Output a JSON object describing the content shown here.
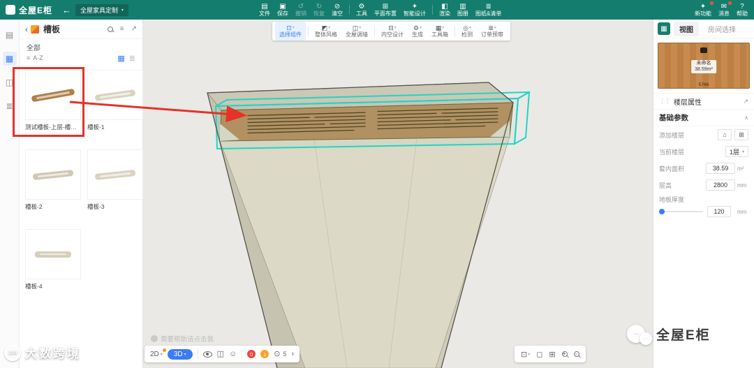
{
  "colors": {
    "topbar": "#157d6e",
    "accent": "#3b7bf6",
    "selection": "#2ed3c6",
    "annotation": "#e63228"
  },
  "app": {
    "logo_text": "全屋E柜",
    "workspace": "全屋家具定制"
  },
  "top_toolbar": {
    "items": [
      {
        "label": "文件",
        "icon": "file-icon"
      },
      {
        "label": "保存",
        "icon": "save-icon"
      },
      {
        "label": "撤销",
        "icon": "undo-icon",
        "disabled": true
      },
      {
        "label": "恢复",
        "icon": "redo-icon",
        "disabled": true
      },
      {
        "label": "清空",
        "icon": "clear-icon"
      },
      {
        "label": "工具",
        "icon": "tools-icon"
      },
      {
        "label": "平面布置",
        "icon": "floorplan-icon"
      },
      {
        "label": "智能设计",
        "icon": "smart-design-icon"
      },
      {
        "label": "渲染",
        "icon": "render-icon"
      },
      {
        "label": "图册",
        "icon": "album-icon"
      },
      {
        "label": "图纸&清单",
        "icon": "drawings-list-icon"
      }
    ],
    "right_items": [
      {
        "label": "新功能",
        "icon": "new-features-icon"
      },
      {
        "label": "消息",
        "icon": "messages-icon"
      },
      {
        "label": "帮助",
        "icon": "help-icon"
      }
    ]
  },
  "mode_toolbar": {
    "items": [
      {
        "label": "选择组件",
        "icon": "select-component-icon",
        "active": true
      },
      {
        "label": "整体风格",
        "icon": "overall-style-icon"
      },
      {
        "label": "全屋调墙",
        "icon": "wall-adjust-icon"
      },
      {
        "label": "内空设计",
        "icon": "interior-design-icon"
      },
      {
        "label": "生成",
        "icon": "generate-icon"
      },
      {
        "label": "工具箱",
        "icon": "toolbox-icon"
      },
      {
        "label": "检测",
        "icon": "detect-icon"
      },
      {
        "label": "订单预审",
        "icon": "order-review-icon"
      }
    ]
  },
  "left_panel": {
    "title": "槽板",
    "filter_all": "全部",
    "group_label": "A-Z",
    "items": [
      {
        "label": "测试槽板-上层-槽板类",
        "highlighted": true
      },
      {
        "label": "槽板-1"
      },
      {
        "label": "槽板-2"
      },
      {
        "label": "槽板-3"
      },
      {
        "label": "槽板-4"
      }
    ]
  },
  "right_panel": {
    "tabs": [
      {
        "label": "视图",
        "active": true
      },
      {
        "label": "房间选择"
      }
    ],
    "preview": {
      "room_name": "未命名",
      "area": "38.59m²",
      "dim_bottom": "5766"
    },
    "floor_section_title": "楼层属性",
    "params_section_title": "基础参数",
    "add_floor_label": "添加楼层",
    "current_floor_label": "当前楼层",
    "current_floor_value": "1层",
    "area_label": "套内面积",
    "area_value": "38.59",
    "area_unit": "m²",
    "height_label": "层高",
    "height_value": "2800",
    "height_unit": "mm",
    "thickness_label": "地板厚度",
    "thickness_value": "120",
    "thickness_unit": "mm"
  },
  "viewport": {
    "help_text": "需要帮助请点击我",
    "view_2d": "2D",
    "view_3d": "3D",
    "badges": {
      "errors": "0",
      "warnings": "1",
      "points": "5"
    }
  },
  "watermarks": {
    "logo_badge": "100",
    "bottom_left_text": "大数跨境",
    "bottom_right_text": "全屋E柜"
  }
}
